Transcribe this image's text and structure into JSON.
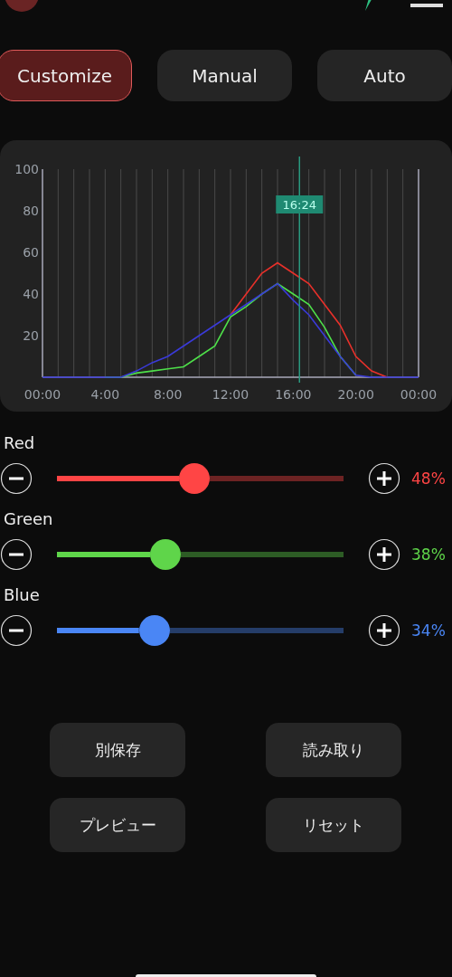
{
  "tabs": [
    {
      "label": "Customize",
      "selected": true
    },
    {
      "label": "Manual",
      "selected": false
    },
    {
      "label": "Auto",
      "selected": false
    }
  ],
  "chart_data": {
    "type": "line",
    "x": [
      0,
      1,
      2,
      3,
      4,
      5,
      6,
      7,
      8,
      9,
      10,
      11,
      12,
      13,
      14,
      15,
      16,
      17,
      18,
      19,
      20,
      21,
      22,
      23,
      24
    ],
    "xlim": [
      0,
      24
    ],
    "ylim": [
      0,
      100
    ],
    "xticks": [
      {
        "value": 0,
        "label": "00:00"
      },
      {
        "value": 4,
        "label": "4:00"
      },
      {
        "value": 8,
        "label": "8:00"
      },
      {
        "value": 12,
        "label": "12:00"
      },
      {
        "value": 16,
        "label": "16:00"
      },
      {
        "value": 20,
        "label": "20:00"
      },
      {
        "value": 24,
        "label": "00:00"
      }
    ],
    "yticks": [
      20,
      40,
      60,
      80,
      100
    ],
    "grid": true,
    "series": [
      {
        "color": "#e8302a",
        "values": [
          null,
          null,
          null,
          null,
          null,
          null,
          null,
          null,
          null,
          null,
          null,
          null,
          30,
          40,
          50,
          55,
          50,
          45,
          35,
          25,
          10,
          3,
          0,
          null,
          null
        ]
      },
      {
        "color": "#4ee04a",
        "values": [
          null,
          null,
          null,
          null,
          0,
          0,
          2,
          3,
          4,
          5,
          10,
          15,
          29,
          34,
          40,
          45,
          40,
          35,
          24,
          10,
          1,
          null,
          null,
          null,
          null
        ]
      },
      {
        "color": "#3a3ad8",
        "values": [
          0,
          0,
          0,
          0,
          0,
          0,
          3,
          7,
          10,
          15,
          20,
          25,
          30,
          35,
          40,
          45,
          37,
          30,
          20,
          10,
          1,
          0,
          0,
          0,
          0
        ]
      }
    ],
    "ref_lines": [
      {
        "axis": "x",
        "value": 16.4,
        "label": "16:24"
      }
    ]
  },
  "channels": [
    {
      "name": "Red",
      "color": "#ff4545",
      "level": 0.48,
      "reading": "48%"
    },
    {
      "name": "Green",
      "color": "#5fd54a",
      "level": 0.38,
      "reading": "38%"
    },
    {
      "name": "Blue",
      "color": "#4a86f5",
      "level": 0.34,
      "reading": "34%"
    }
  ],
  "buttons": [
    "別保存",
    "読み取り",
    "プレビュー",
    "リセット"
  ]
}
